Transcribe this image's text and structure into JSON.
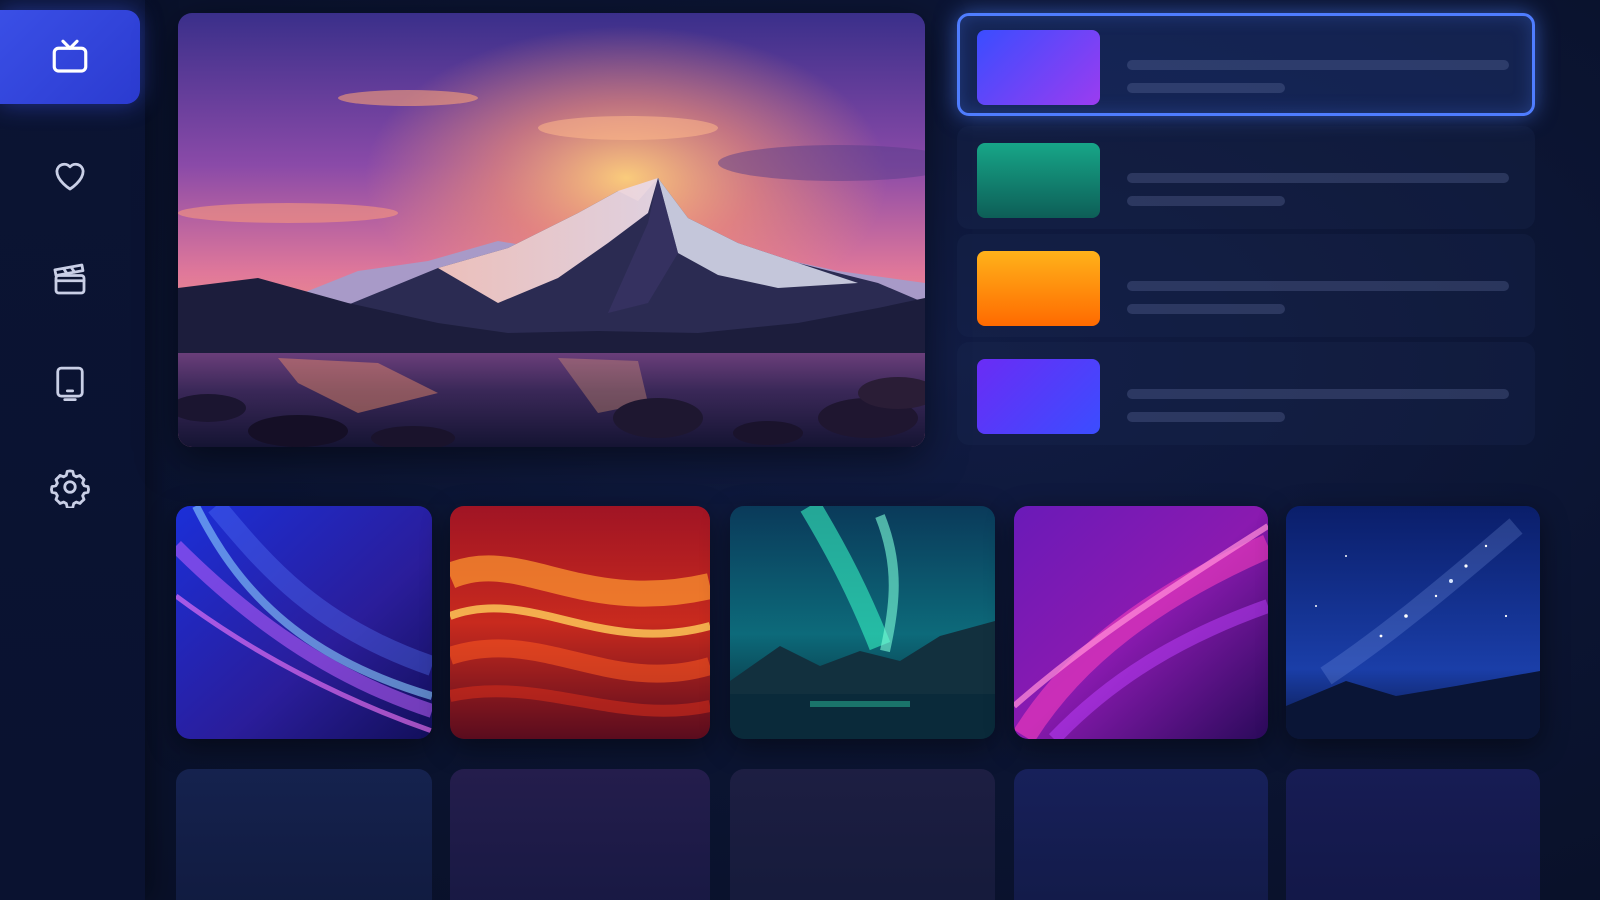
{
  "sidebar": {
    "items": [
      {
        "id": "tv",
        "icon": "tv-icon",
        "active": true
      },
      {
        "id": "favorites",
        "icon": "heart-icon",
        "active": false
      },
      {
        "id": "movies",
        "icon": "clapperboard-icon",
        "active": false
      },
      {
        "id": "device",
        "icon": "tablet-icon",
        "active": false
      },
      {
        "id": "settings",
        "icon": "gear-icon",
        "active": false
      }
    ]
  },
  "hero": {
    "image": "mountain-sunset-lake"
  },
  "channel_list": [
    {
      "thumb_colors": [
        "#3a4dff",
        "#9b3cf0"
      ],
      "focused": true
    },
    {
      "thumb_colors": [
        "#17a688",
        "#0d5e57"
      ],
      "focused": false
    },
    {
      "thumb_colors": [
        "#ffb21a",
        "#ff6a00"
      ],
      "focused": false
    },
    {
      "thumb_colors": [
        "#6a2cf5",
        "#3b4dff"
      ],
      "focused": false
    }
  ],
  "tiles_row1": [
    {
      "image": "blue-purple-wave"
    },
    {
      "image": "red-orange-wave"
    },
    {
      "image": "aurora-lake"
    },
    {
      "image": "magenta-wave"
    },
    {
      "image": "starry-night"
    }
  ],
  "tiles_row2_colors": [
    "#15224e",
    "#241d4c",
    "#1d1e42",
    "#17205a",
    "#171c54"
  ]
}
